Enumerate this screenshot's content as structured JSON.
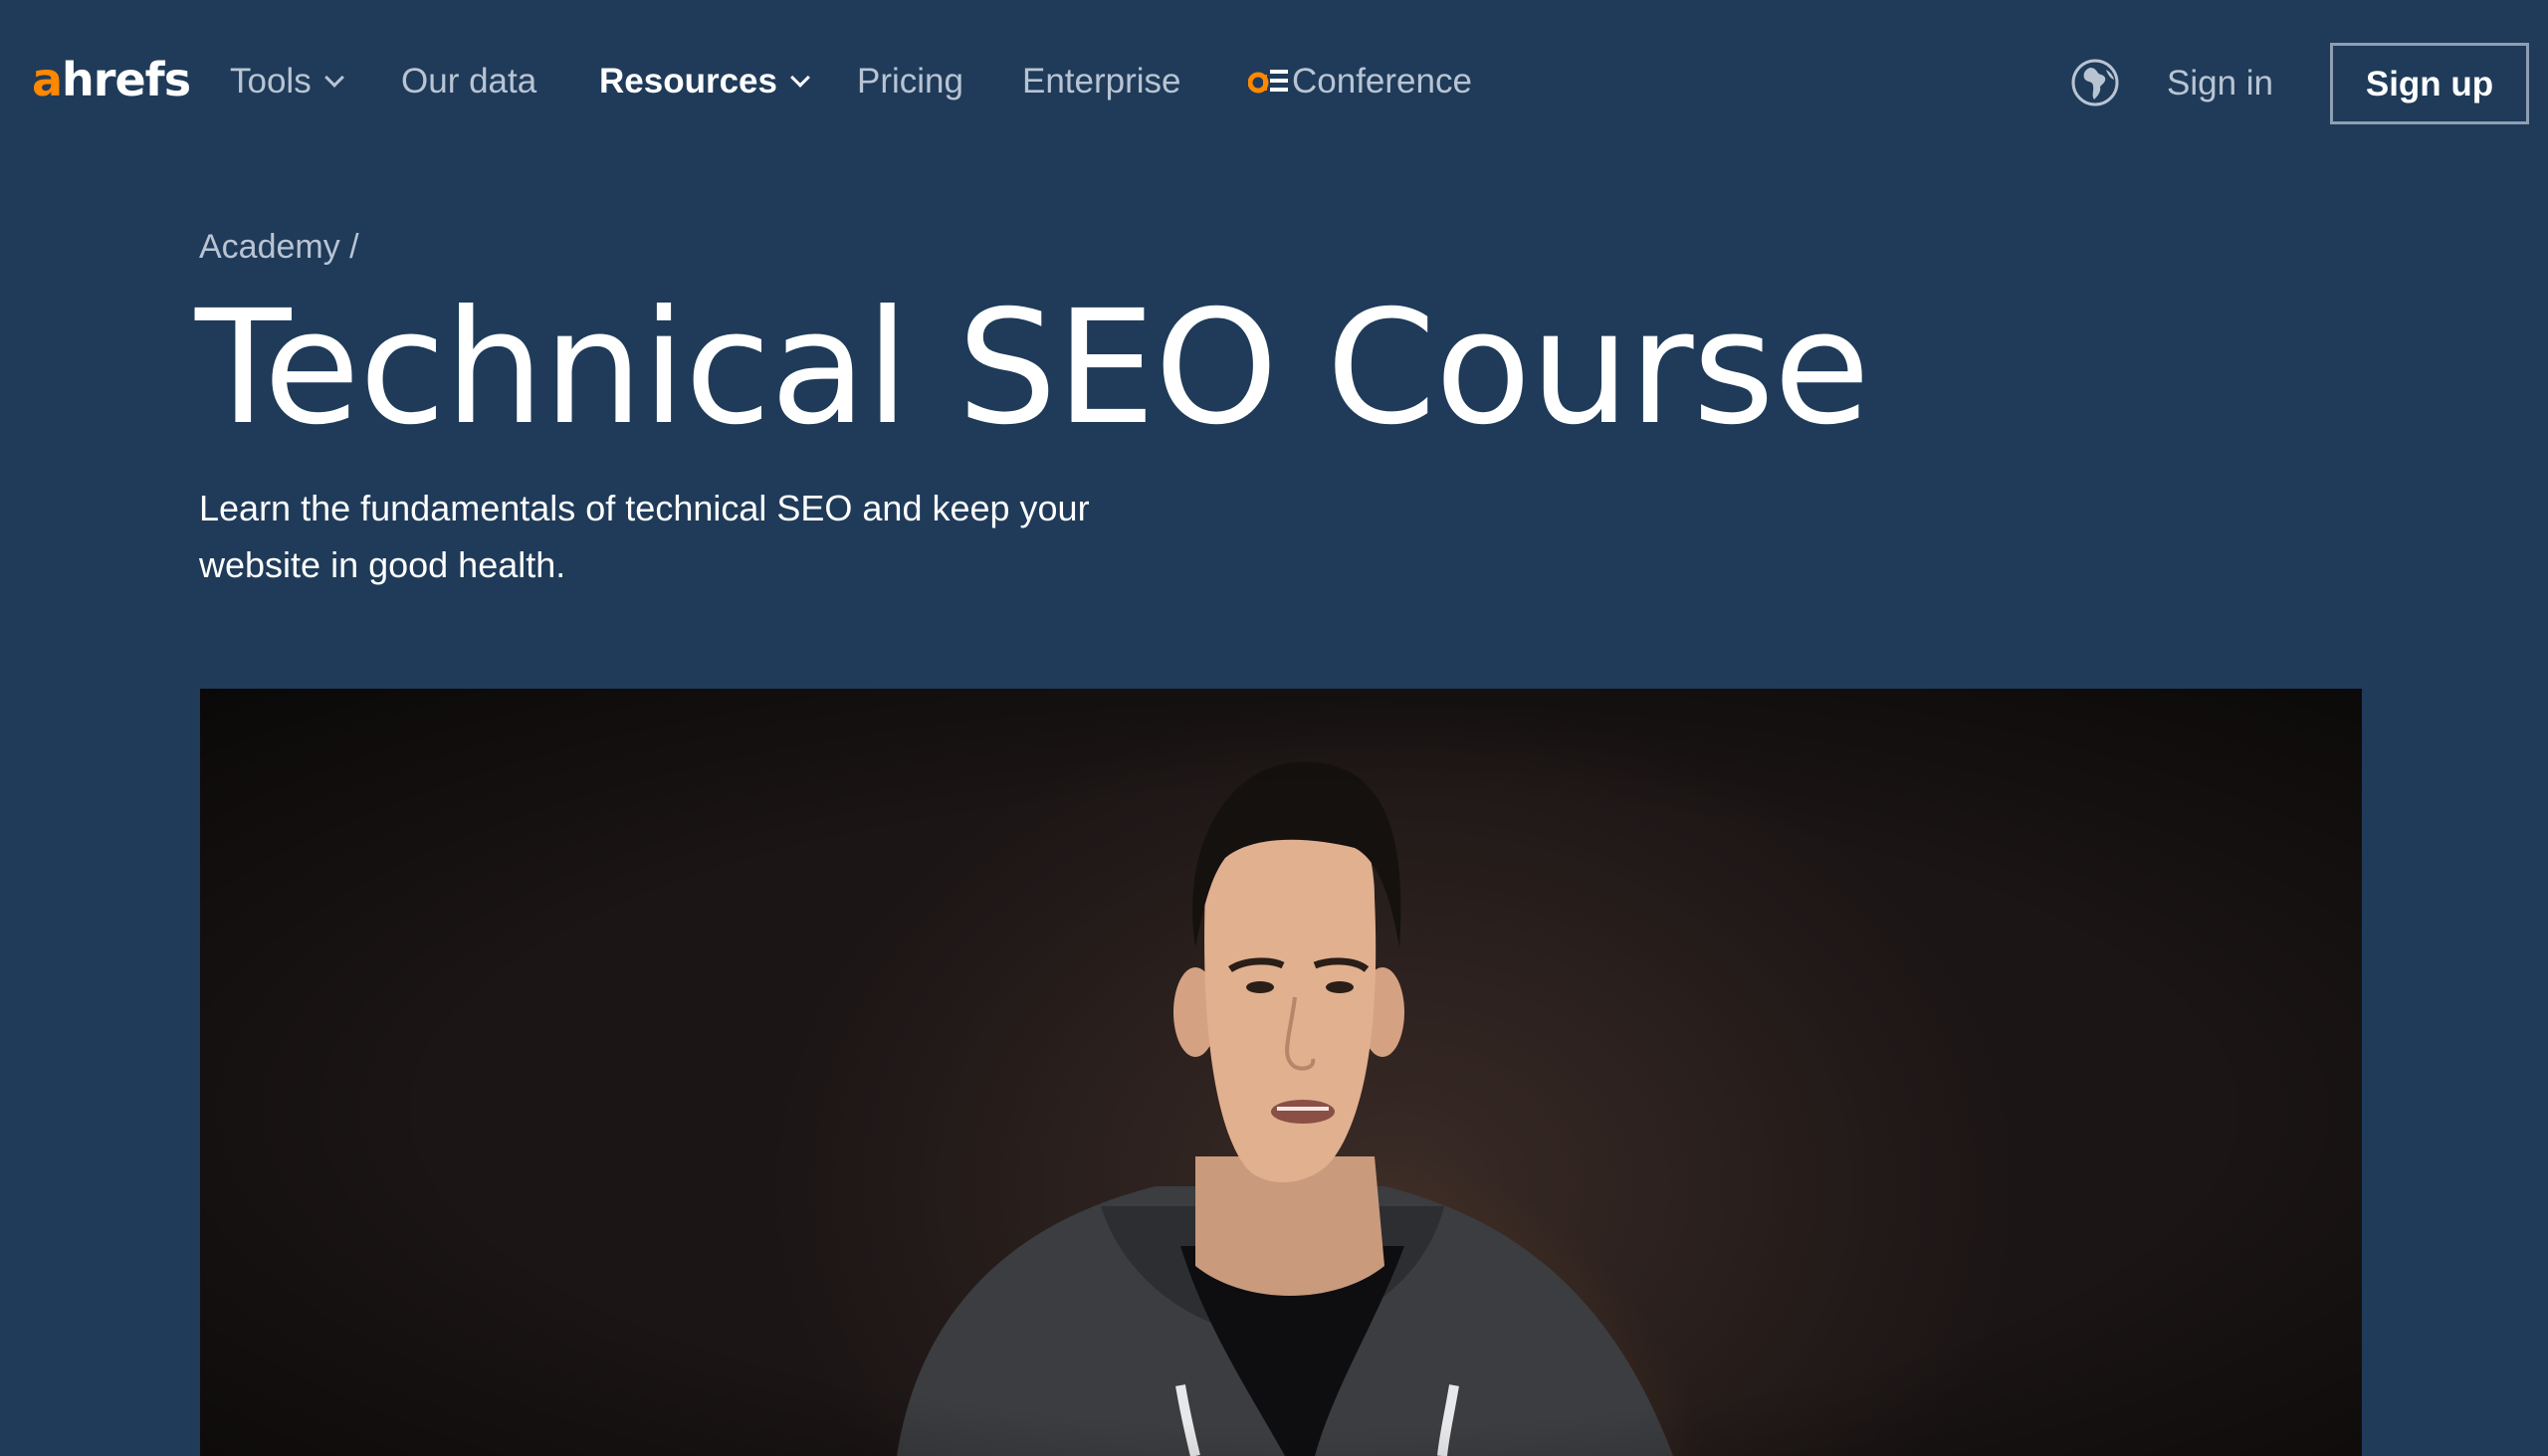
{
  "nav": {
    "logo_prefix": "a",
    "logo_suffix": "hrefs",
    "items": [
      {
        "label": "Tools",
        "has_dropdown": true
      },
      {
        "label": "Our data",
        "has_dropdown": false
      },
      {
        "label": "Resources",
        "has_dropdown": true,
        "active": true
      },
      {
        "label": "Pricing",
        "has_dropdown": false
      },
      {
        "label": "Enterprise",
        "has_dropdown": false
      },
      {
        "label": "Conference",
        "has_dropdown": false,
        "icon": "ae-conference-icon"
      }
    ],
    "language_icon": "globe-icon",
    "sign_in": "Sign in",
    "sign_up": "Sign up"
  },
  "hero": {
    "breadcrumb": "Academy /",
    "title": "Technical SEO Course",
    "subtitle_line1": "Learn the fundamentals of technical SEO and keep your",
    "subtitle_line2": "website in good health."
  },
  "colors": {
    "background": "#1f3b59",
    "brand_orange": "#ff8800",
    "nav_text": "#b9c4d3",
    "white": "#ffffff"
  }
}
